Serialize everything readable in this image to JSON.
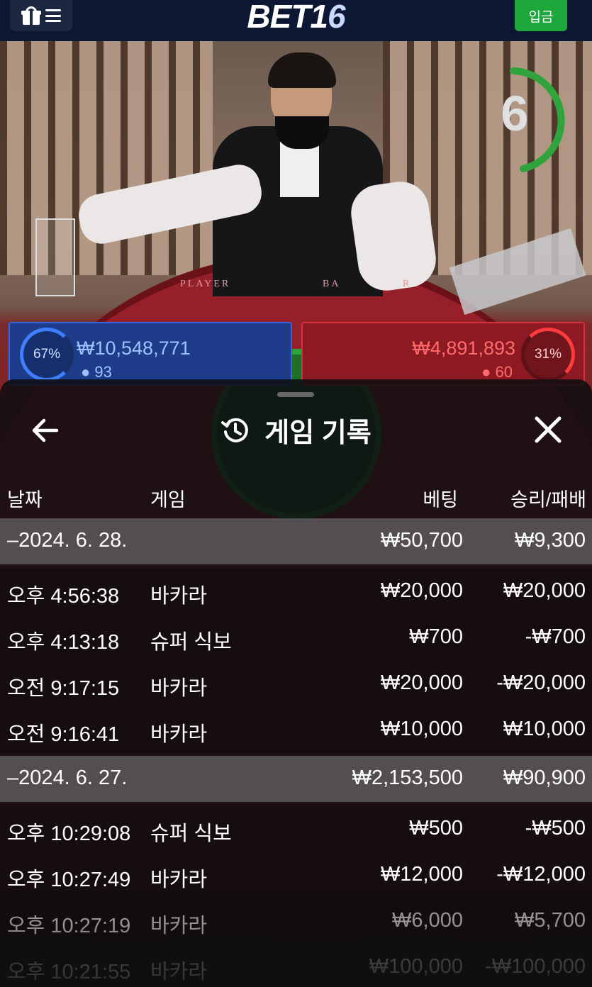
{
  "header": {
    "logo_main": "BET1",
    "logo_accent": "6",
    "deposit_label": "입금",
    "menu_icons": [
      "gift-icon",
      "hamburger-icon"
    ]
  },
  "stream": {
    "timer_value": "6",
    "timer_color": "#2fa43d",
    "table_labels": [
      "PLAYER",
      "BA",
      "R"
    ],
    "player_panel": {
      "percent": "67%",
      "amount": "₩10,548,771",
      "count": "93",
      "color": "#3565e0"
    },
    "banker_panel": {
      "percent": "31%",
      "amount": "₩4,891,893",
      "count": "60",
      "color": "#d9303d"
    }
  },
  "modal": {
    "title": "게임 기록",
    "back_icon": "arrow-left-icon",
    "title_icon": "history-icon",
    "close_icon": "close-icon",
    "columns": {
      "date": "날짜",
      "game": "게임",
      "bet": "베팅",
      "result": "승리/패배"
    },
    "groups": [
      {
        "date": "–2024. 6. 28.",
        "total_bet": "₩50,700",
        "total_result": "₩9,300",
        "rows": [
          {
            "time": "오후 4:56:38",
            "game": "바카라",
            "bet": "₩20,000",
            "result": "₩20,000"
          },
          {
            "time": "오후 4:13:18",
            "game": "슈퍼 식보",
            "bet": "₩700",
            "result": "-₩700"
          },
          {
            "time": "오전 9:17:15",
            "game": "바카라",
            "bet": "₩20,000",
            "result": "-₩20,000"
          },
          {
            "time": "오전 9:16:41",
            "game": "바카라",
            "bet": "₩10,000",
            "result": "₩10,000"
          }
        ]
      },
      {
        "date": "–2024. 6. 27.",
        "total_bet": "₩2,153,500",
        "total_result": "₩90,900",
        "rows": [
          {
            "time": "오후 10:29:08",
            "game": "슈퍼 식보",
            "bet": "₩500",
            "result": "-₩500"
          },
          {
            "time": "오후 10:27:49",
            "game": "바카라",
            "bet": "₩12,000",
            "result": "-₩12,000"
          },
          {
            "time": "오후 10:27:19",
            "game": "바카라",
            "bet": "₩6,000",
            "result": "₩5,700"
          },
          {
            "time": "오후 10:21:55",
            "game": "바카라",
            "bet": "₩100,000",
            "result": "-₩100,000"
          }
        ]
      }
    ]
  }
}
